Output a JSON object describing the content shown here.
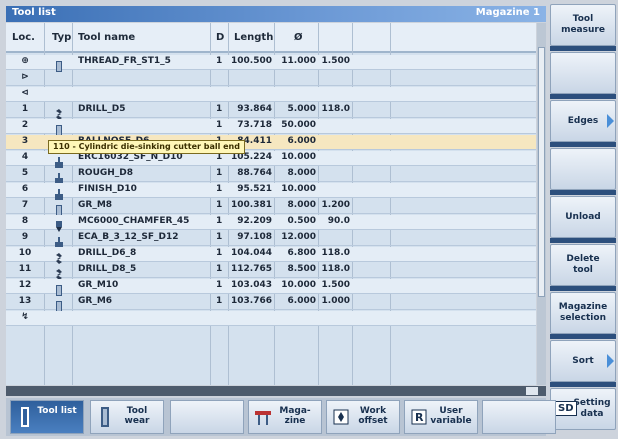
{
  "title": "Tool list",
  "magazine": "Magazine 1",
  "columns": {
    "loc": "Loc.",
    "type": "Typ",
    "name": "Tool name",
    "d": "D",
    "length": "Length",
    "radius": "Ø"
  },
  "tooltip": "110 - Cylindric die-sinking cutter ball end",
  "rows": [
    {
      "loc": "⊕",
      "name": "THREAD_FR_ST1_5",
      "d": "1",
      "len": "100.500",
      "rad": "11.000",
      "ex": "1.500",
      "type": "mill"
    },
    {
      "loc": "⊳",
      "name": "",
      "d": "",
      "len": "",
      "rad": "",
      "ex": "",
      "type": ""
    },
    {
      "loc": "⊲",
      "name": "",
      "d": "",
      "len": "",
      "rad": "",
      "ex": "",
      "type": ""
    },
    {
      "loc": "1",
      "name": "DRILL_D5",
      "d": "1",
      "len": "93.864",
      "rad": "5.000",
      "ex": "118.0",
      "type": "drill"
    },
    {
      "loc": "2",
      "name": "",
      "d": "1",
      "len": "73.718",
      "rad": "50.000",
      "ex": "",
      "type": "mill"
    },
    {
      "loc": "3",
      "name": "BALLNOSE_D6",
      "d": "1",
      "len": "84.411",
      "rad": "6.000",
      "ex": "",
      "type": "ballnose"
    },
    {
      "loc": "4",
      "name": "ERC16032_SF_N_D10",
      "d": "1",
      "len": "105.224",
      "rad": "10.000",
      "ex": "",
      "type": "endmill"
    },
    {
      "loc": "5",
      "name": "ROUGH_D8",
      "d": "1",
      "len": "88.764",
      "rad": "8.000",
      "ex": "",
      "type": "endmill"
    },
    {
      "loc": "6",
      "name": "FINISH_D10",
      "d": "1",
      "len": "95.521",
      "rad": "10.000",
      "ex": "",
      "type": "endmill"
    },
    {
      "loc": "7",
      "name": "GR_M8",
      "d": "1",
      "len": "100.381",
      "rad": "8.000",
      "ex": "1.200",
      "type": "mill"
    },
    {
      "loc": "8",
      "name": "MC6000_CHAMFER_45",
      "d": "1",
      "len": "92.209",
      "rad": "0.500",
      "ex": "90.0",
      "type": "chamfer"
    },
    {
      "loc": "9",
      "name": "ECA_B_3_12_SF_D12",
      "d": "1",
      "len": "97.108",
      "rad": "12.000",
      "ex": "",
      "type": "endmill"
    },
    {
      "loc": "10",
      "name": "DRILL_D6_8",
      "d": "1",
      "len": "104.044",
      "rad": "6.800",
      "ex": "118.0",
      "type": "drill"
    },
    {
      "loc": "11",
      "name": "DRILL_D8_5",
      "d": "1",
      "len": "112.765",
      "rad": "8.500",
      "ex": "118.0",
      "type": "drill"
    },
    {
      "loc": "12",
      "name": "GR_M10",
      "d": "1",
      "len": "103.043",
      "rad": "10.000",
      "ex": "1.500",
      "type": "mill"
    },
    {
      "loc": "13",
      "name": "GR_M6",
      "d": "1",
      "len": "103.766",
      "rad": "6.000",
      "ex": "1.000",
      "type": "mill"
    },
    {
      "loc": "↯",
      "name": "",
      "d": "",
      "len": "",
      "rad": "",
      "ex": "",
      "type": ""
    }
  ],
  "right_keys": [
    "Tool measure",
    "",
    "Edges",
    "",
    "Unload",
    "Delete tool",
    "Magazine selection",
    "Sort",
    "Setting data"
  ],
  "bottom_keys": [
    {
      "label": "Tool list",
      "active": true
    },
    {
      "label": "Tool wear",
      "active": false
    },
    {
      "label": "",
      "active": false
    },
    {
      "label": "Maga-zine",
      "active": false
    },
    {
      "label": "Work offset",
      "active": false
    },
    {
      "label": "User variable",
      "active": false
    },
    {
      "label": "",
      "active": false
    }
  ],
  "sd_label": "SD"
}
